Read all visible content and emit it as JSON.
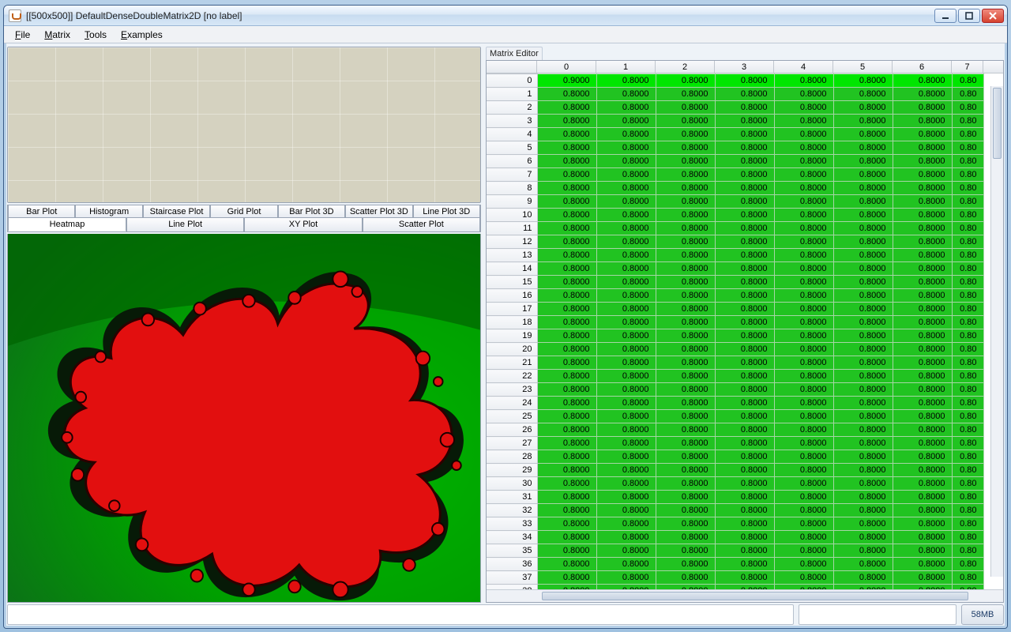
{
  "window": {
    "title": "[[500x500]] DefaultDenseDoubleMatrix2D [no label]"
  },
  "menubar": [
    "File",
    "Matrix",
    "Tools",
    "Examples"
  ],
  "tabs_row1": [
    "Bar Plot",
    "Histogram",
    "Staircase Plot",
    "Grid Plot",
    "Bar Plot 3D",
    "Scatter Plot 3D",
    "Line Plot 3D"
  ],
  "tabs_row2": [
    "Heatmap",
    "Line Plot",
    "XY Plot",
    "Scatter Plot"
  ],
  "tabs_selected": "Heatmap",
  "editor": {
    "title": "Matrix Editor",
    "col_headers": [
      "0",
      "1",
      "2",
      "3",
      "4",
      "5",
      "6",
      "7"
    ],
    "rows": 41,
    "first_cell_value": "0.9000",
    "cell_value": "0.8000",
    "last_cell_value": "0.80"
  },
  "status": {
    "memory": "58MB"
  },
  "chart_data": {
    "type": "heatmap",
    "title": "",
    "rows": 500,
    "cols": 500,
    "value_range": [
      0.0,
      1.0
    ],
    "background_value": 0.8,
    "interior_value": 0.0,
    "top_left_value": 0.9,
    "colormap": "green-red (low=red interior, high=green exterior)",
    "note": "Mandelbrot-set iteration-count matrix; exterior ≈0.8 (green), set interior ≈0 (red)"
  }
}
